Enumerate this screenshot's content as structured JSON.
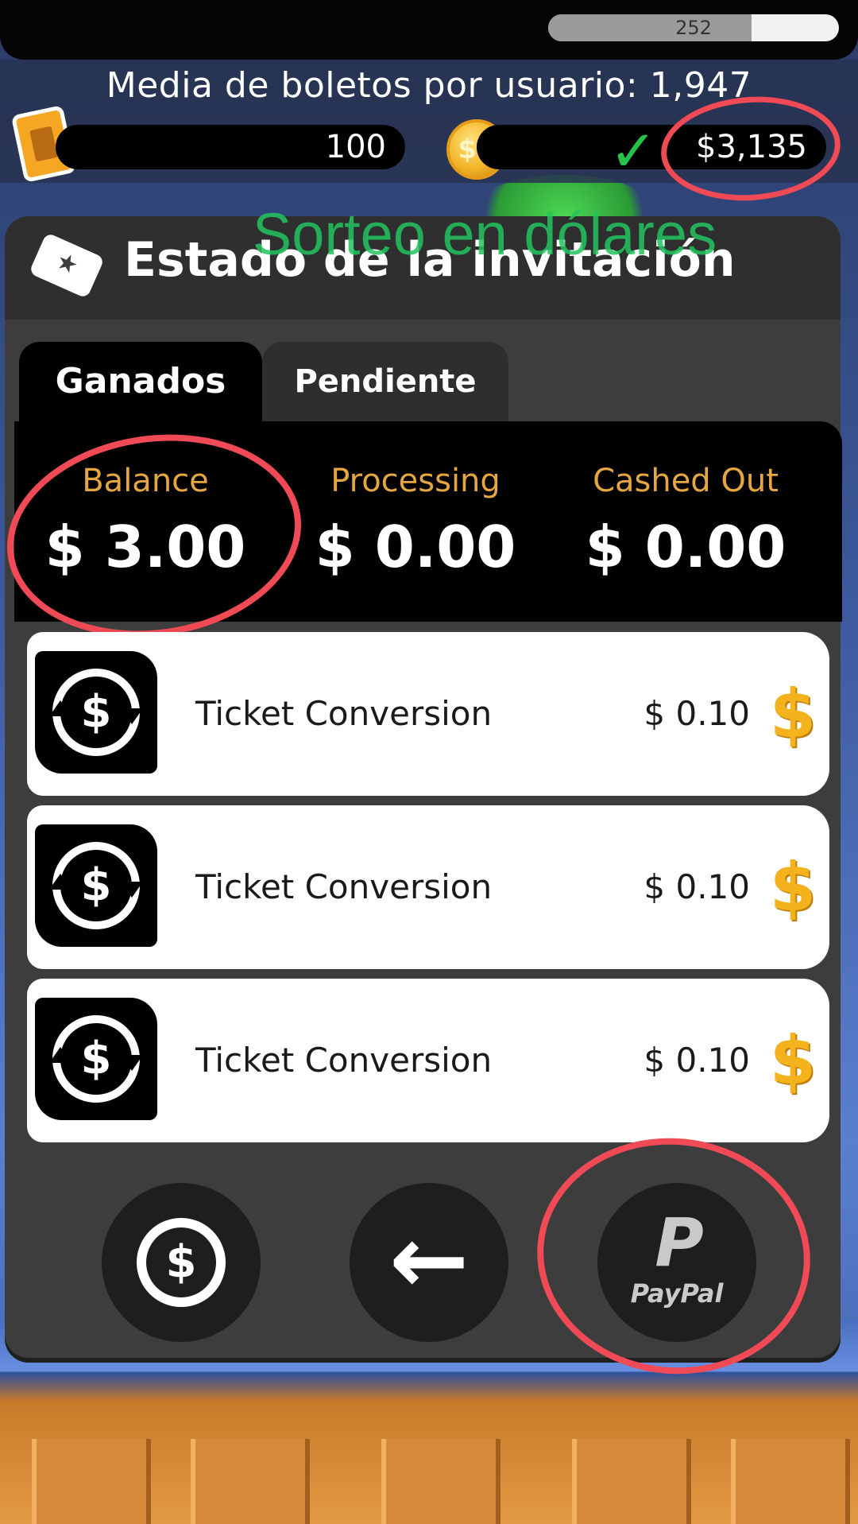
{
  "hud": {
    "level_value": "252",
    "level_progress": 0.7,
    "average_text": "Media de boletos por usuario: 1,947",
    "tickets": "100",
    "coin_label": "$1",
    "cash": "$3,135"
  },
  "overlay": {
    "note": "Sorteo en dólares"
  },
  "panel": {
    "title": "Estado de la invitación",
    "tabs": [
      {
        "label": "Ganados",
        "active": true
      },
      {
        "label": "Pendiente",
        "active": false
      }
    ],
    "summary": [
      {
        "label": "Balance",
        "value": "$ 3.00"
      },
      {
        "label": "Processing",
        "value": "$ 0.00"
      },
      {
        "label": "Cashed Out",
        "value": "$ 0.00"
      }
    ],
    "rows": [
      {
        "label": "Ticket Conversion",
        "amount": "$ 0.10"
      },
      {
        "label": "Ticket Conversion",
        "amount": "$ 0.10"
      },
      {
        "label": "Ticket Conversion",
        "amount": "$ 0.10"
      }
    ],
    "paypal_label": "PayPal",
    "paypal_letter": "P"
  },
  "colors": {
    "accent_gold": "#e6a640",
    "annotation_red": "#ef4a55",
    "overlay_green": "#22c55e"
  }
}
